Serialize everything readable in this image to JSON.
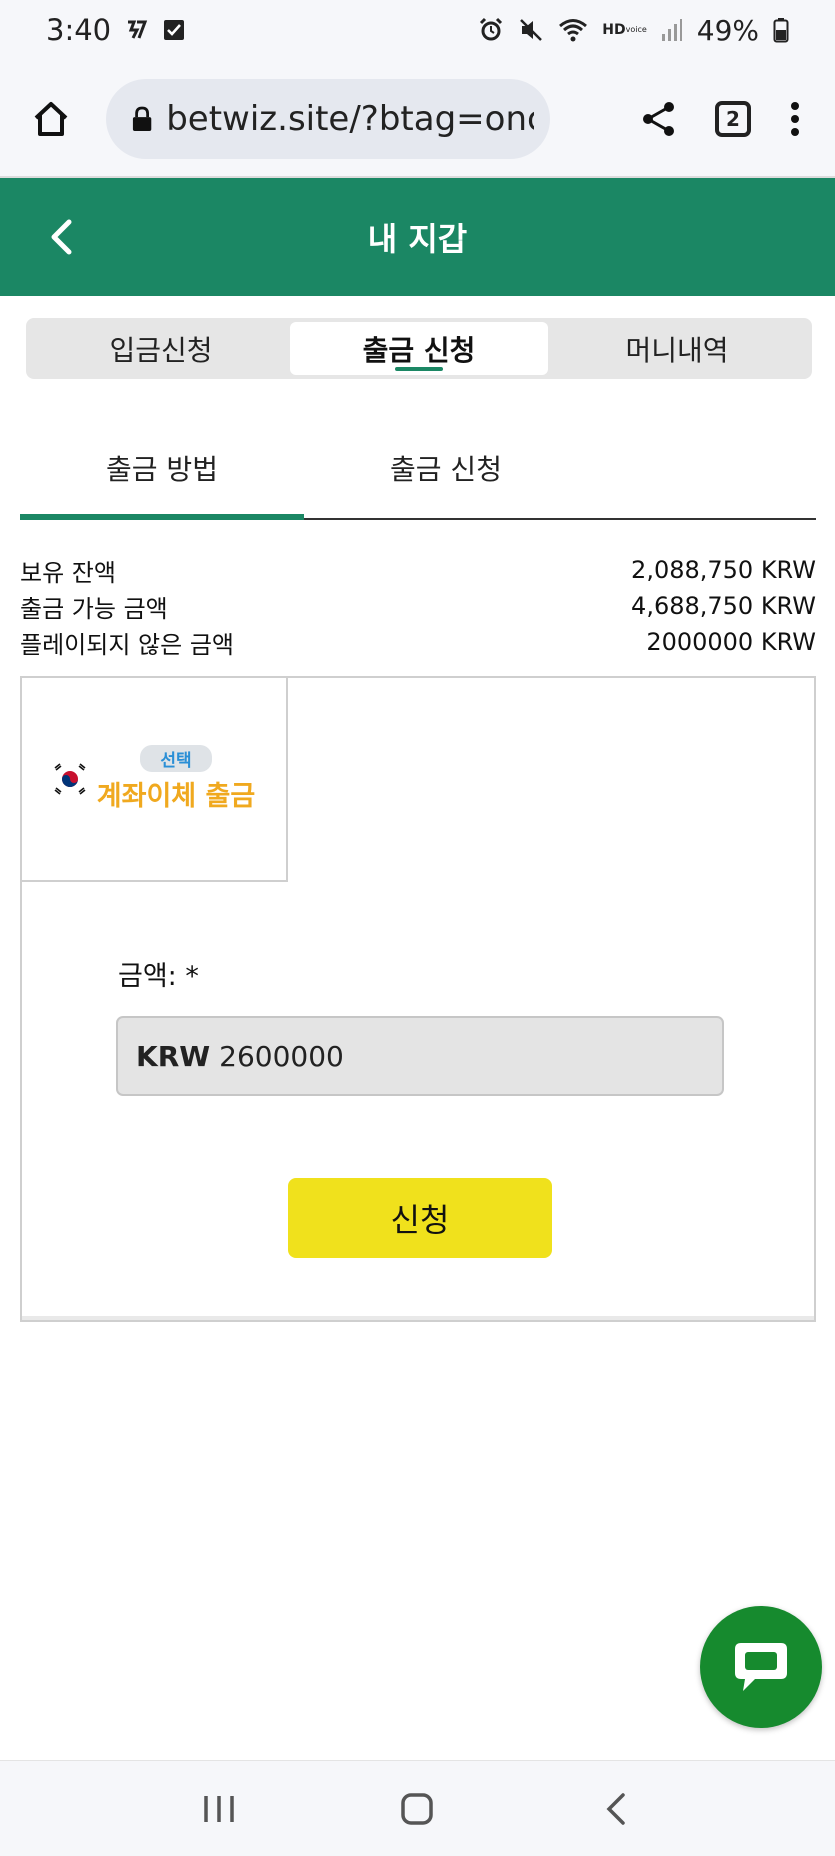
{
  "status_bar": {
    "time": "3:40",
    "battery": "49%",
    "network_badge_top": "HD",
    "network_badge_bottom": "voice"
  },
  "browser": {
    "url": "betwiz.site/?btag=onca",
    "tab_count": "2"
  },
  "header": {
    "title": "내 지갑"
  },
  "top_tabs": [
    {
      "label": "입금신청"
    },
    {
      "label": "출금 신청"
    },
    {
      "label": "머니내역"
    }
  ],
  "sub_tabs": [
    {
      "label": "출금 방법"
    },
    {
      "label": "출금 신청"
    }
  ],
  "balances": [
    {
      "label": "보유 잔액",
      "value": "2,088,750 KRW"
    },
    {
      "label": "출금 가능 금액",
      "value": "4,688,750 KRW"
    },
    {
      "label": "플레이되지 않은 금액",
      "value": "2000000 KRW"
    }
  ],
  "method": {
    "badge": "선택",
    "name": "계좌이체 출금"
  },
  "form": {
    "amount_label": "금액: *",
    "currency": "KRW",
    "amount_value": "2600000",
    "submit_label": "신청"
  },
  "colors": {
    "brand_green": "#1b8764",
    "submit_yellow": "#f0e11c",
    "chat_green": "#168a2e",
    "method_orange": "#f0a91f",
    "method_badge_blue": "#2a8fd6"
  }
}
